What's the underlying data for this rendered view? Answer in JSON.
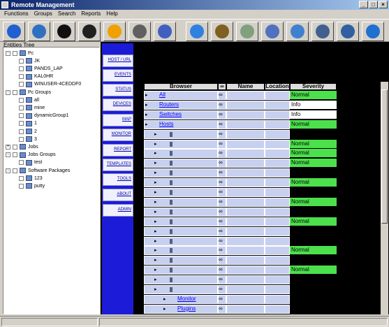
{
  "window": {
    "title": "Remote Management"
  },
  "menu": [
    "Functions",
    "Groups",
    "Search",
    "Reports",
    "Help"
  ],
  "toolbar": [
    {
      "icon": "info-icon",
      "color": "#2060d0"
    },
    {
      "icon": "globe-icon",
      "color": "#3070c0"
    },
    {
      "icon": "console-icon",
      "color": "#101010"
    },
    {
      "icon": "screen-icon",
      "color": "#202020"
    },
    {
      "icon": "radiation-icon",
      "color": "#f0a000"
    },
    {
      "icon": "battery-icon",
      "color": "#606060"
    },
    {
      "icon": "monitor-icon",
      "color": "#4060c0"
    },
    {
      "icon": "network-icon",
      "color": "#3080e0"
    },
    {
      "icon": "books-icon",
      "color": "#806020"
    },
    {
      "icon": "cd-icon",
      "color": "#80a080"
    },
    {
      "icon": "computer-icon",
      "color": "#5070c0"
    },
    {
      "icon": "magnifier-icon",
      "color": "#4080d0"
    },
    {
      "icon": "drive-icon",
      "color": "#406090"
    },
    {
      "icon": "remote-icon",
      "color": "#3060a0"
    },
    {
      "icon": "refresh-icon",
      "color": "#2070d0"
    }
  ],
  "tree": {
    "label": "Entities Tree",
    "nodes": [
      {
        "label": "Pc",
        "level": 0,
        "expand": "-"
      },
      {
        "label": "JK",
        "level": 1
      },
      {
        "label": "PANDS_LAP",
        "level": 1
      },
      {
        "label": "KAL0HR",
        "level": 1
      },
      {
        "label": "WINUSER-4CEDDF0",
        "level": 1
      },
      {
        "label": "Pc Groups",
        "level": 0,
        "expand": "-"
      },
      {
        "label": "all",
        "level": 1
      },
      {
        "label": "mine",
        "level": 1
      },
      {
        "label": "dynamicGroup1",
        "level": 1
      },
      {
        "label": "1",
        "level": 1
      },
      {
        "label": "2",
        "level": 1
      },
      {
        "label": "3",
        "level": 1
      },
      {
        "label": "Jobs",
        "level": 0,
        "expand": "+"
      },
      {
        "label": "Jobs Groups",
        "level": 0,
        "expand": "-"
      },
      {
        "label": "test",
        "level": 1
      },
      {
        "label": "Software Packages",
        "level": 0,
        "expand": "-"
      },
      {
        "label": "123",
        "level": 1
      },
      {
        "label": "putty",
        "level": 1
      }
    ]
  },
  "nav": [
    "HOST / URL",
    "EVENTS",
    "STATUS",
    "DEVICES",
    "MAP",
    "MONITOR",
    "REPORT",
    "TEMPLATES",
    "TOOLS",
    "ABOUT",
    "ADMIN"
  ],
  "grid": {
    "headers": [
      "Browser",
      "",
      "Name",
      "Location",
      "Severity"
    ],
    "rows": [
      {
        "label": "All",
        "sev": "Normal",
        "indent": 0
      },
      {
        "label": "Routers",
        "sev": "Info",
        "indent": 0
      },
      {
        "label": "Switches",
        "sev": "Info",
        "indent": 0
      },
      {
        "label": "Hosts",
        "sev": "Normal",
        "indent": 0
      },
      {
        "label": "",
        "sev": "",
        "indent": 1
      },
      {
        "label": "",
        "sev": "Normal",
        "indent": 1
      },
      {
        "label": "",
        "sev": "Normal",
        "indent": 1
      },
      {
        "label": "",
        "sev": "Normal",
        "indent": 1
      },
      {
        "label": "",
        "sev": "",
        "indent": 1
      },
      {
        "label": "",
        "sev": "Normal",
        "indent": 1
      },
      {
        "label": "",
        "sev": "",
        "indent": 1
      },
      {
        "label": "",
        "sev": "Normal",
        "indent": 1
      },
      {
        "label": "",
        "sev": "",
        "indent": 1
      },
      {
        "label": "",
        "sev": "Normal",
        "indent": 1
      },
      {
        "label": "",
        "sev": "",
        "indent": 1
      },
      {
        "label": "",
        "sev": "",
        "indent": 1
      },
      {
        "label": "",
        "sev": "Normal",
        "indent": 1
      },
      {
        "label": "",
        "sev": "",
        "indent": 1
      },
      {
        "label": "",
        "sev": "Normal",
        "indent": 1
      },
      {
        "label": "",
        "sev": "",
        "indent": 1
      },
      {
        "label": "",
        "sev": "",
        "indent": 1
      },
      {
        "label": "Monitor",
        "sev": "",
        "indent": 2
      },
      {
        "label": "Plugins",
        "sev": "",
        "indent": 2
      }
    ]
  },
  "colors": {
    "normal": "#4ce04c",
    "info": "#ffffff",
    "nav": "#1c1cd8"
  }
}
